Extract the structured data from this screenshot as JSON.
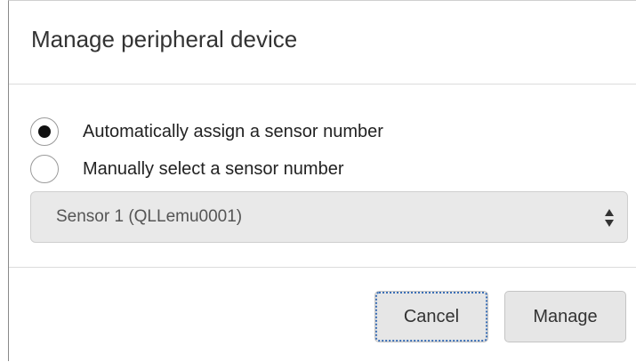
{
  "dialog": {
    "title": "Manage peripheral device",
    "options": [
      {
        "label": "Automatically assign a sensor number",
        "checked": true
      },
      {
        "label": "Manually select a sensor number",
        "checked": false
      }
    ],
    "sensor_select": {
      "value": "Sensor 1 (QLLemu0001)",
      "icon": "updown-arrows-icon"
    },
    "buttons": {
      "cancel_label": "Cancel",
      "manage_label": "Manage"
    }
  }
}
